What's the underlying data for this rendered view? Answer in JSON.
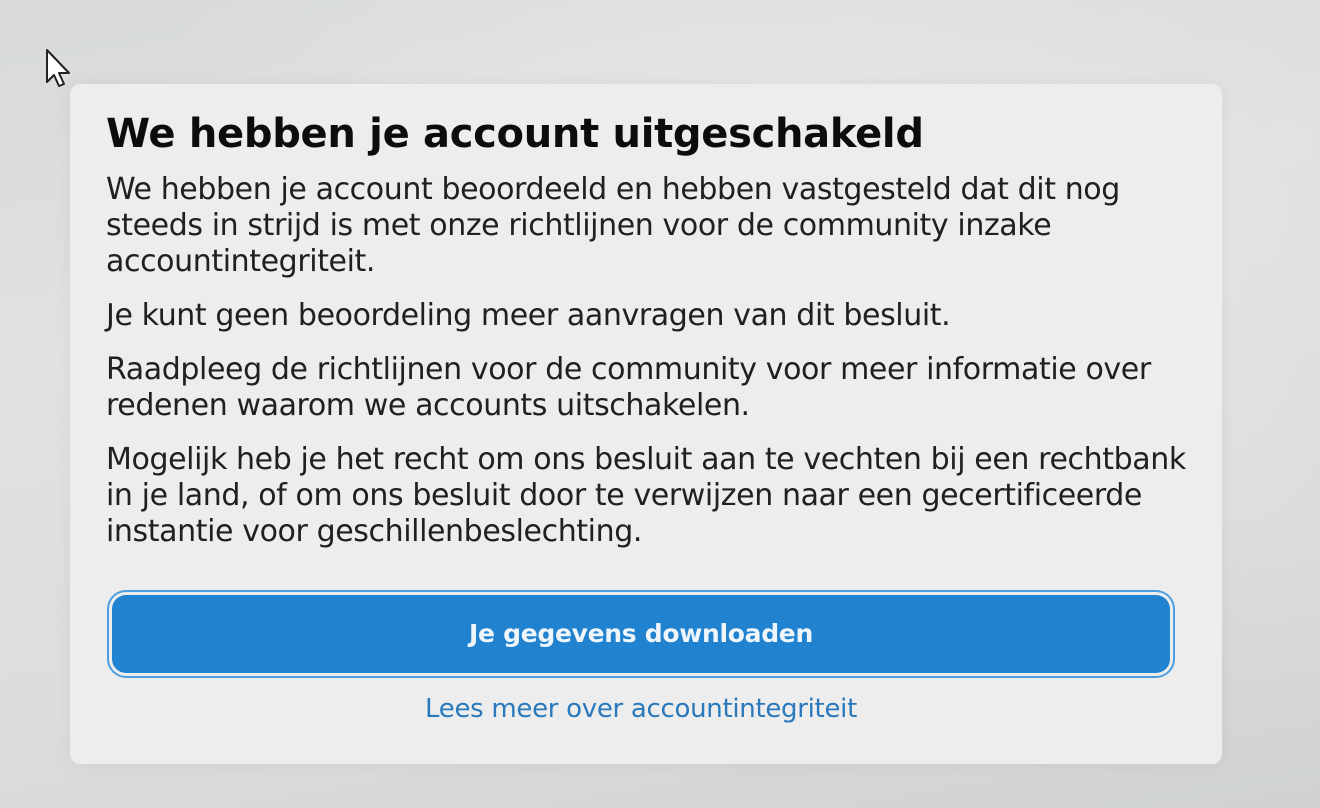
{
  "dialog": {
    "title": "We hebben je account uitgeschakeld",
    "paragraphs": [
      "We hebben je account beoordeeld en hebben vastgesteld dat dit nog steeds in strijd is met onze richtlijnen voor de community inzake accountintegriteit.",
      "Je kunt geen beoordeling meer aanvragen van dit besluit.",
      "Raadpleeg de richtlijnen voor de community voor meer informatie over redenen waarom we accounts uitschakelen.",
      "Mogelijk heb je het recht om ons besluit aan te vechten bij een rechtbank in je land, of om ons besluit door te verwijzen naar een gecertificeerde instantie voor geschillenbeslechting."
    ],
    "primary_button_label": "Je gegevens downloaden",
    "link_label": "Lees meer over accountintegriteit"
  },
  "colors": {
    "primary_button": "#2183d0",
    "link": "#2a79bd",
    "dialog_background": "#ecedec"
  },
  "icons": {
    "cursor": "mouse-pointer-icon"
  }
}
